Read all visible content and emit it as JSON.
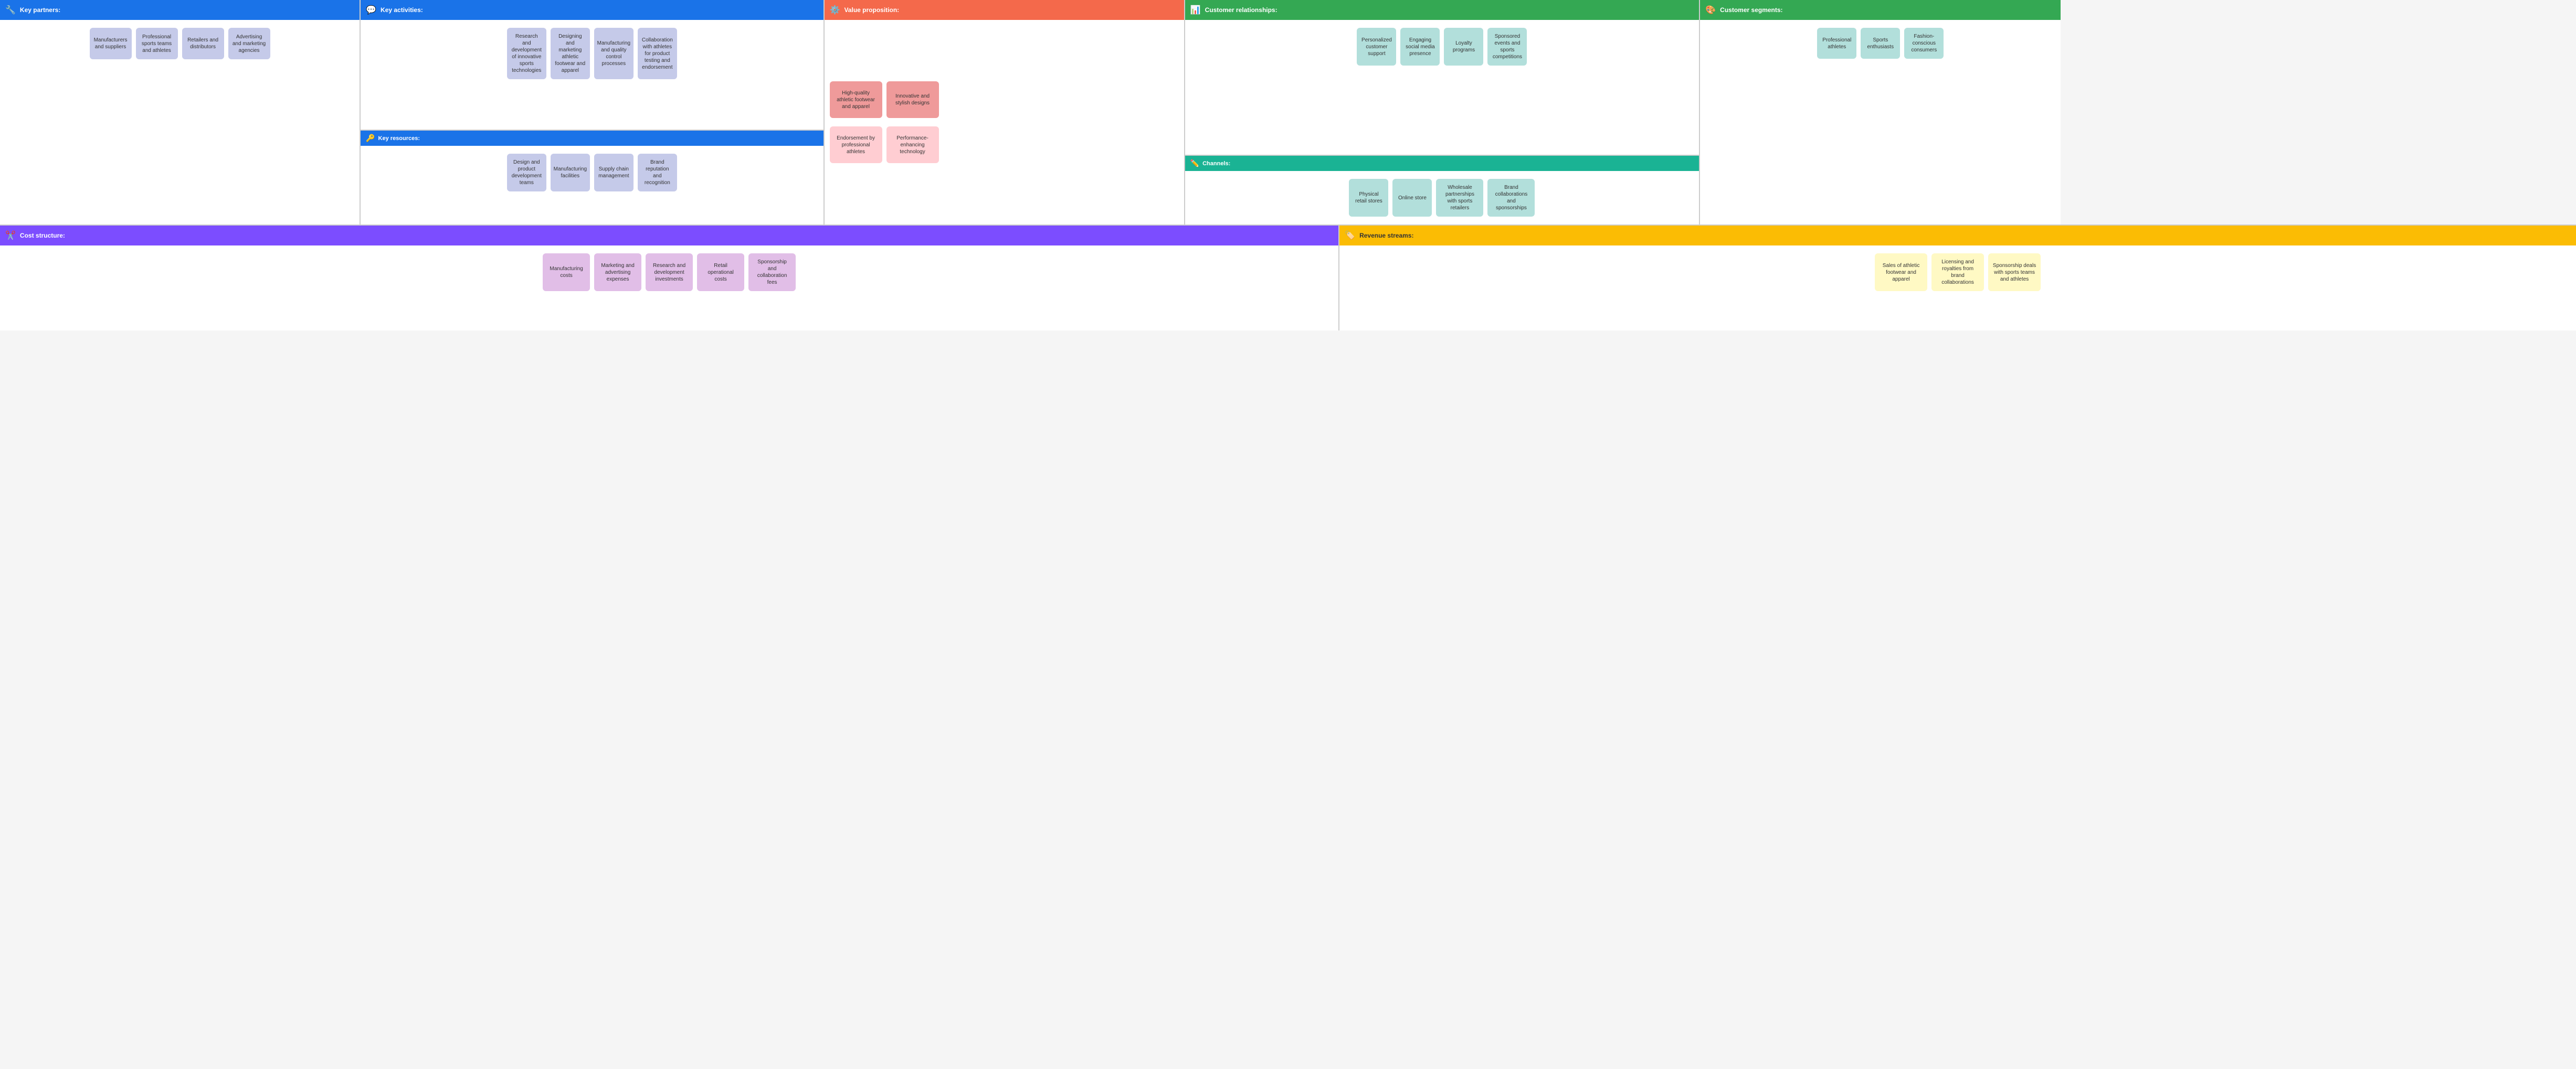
{
  "sections": {
    "keyPartners": {
      "title": "Key partners:",
      "icon": "🔧",
      "cards": [
        "Manufacturers and suppliers",
        "Professional sports teams and athletes",
        "Retailers and distributors",
        "Advertising and marketing agencies"
      ]
    },
    "keyActivities": {
      "title": "Key activities:",
      "icon": "💬",
      "cards": [
        "Research and development of innovative sports technologies",
        "Designing and marketing athletic footwear and apparel",
        "Manufacturing and quality control processes",
        "Collaboration with athletes for product testing and endorsement"
      ]
    },
    "keyResources": {
      "title": "Key resources:",
      "icon": "🔑",
      "cards": [
        "Design and product development teams",
        "Manufacturing facilities",
        "Supply chain management",
        "Brand reputation and recognition"
      ]
    },
    "valueProposition": {
      "title": "Value proposition:",
      "icon": "⚙️",
      "cards": [
        "High-quality athletic footwear and apparel",
        "Innovative and stylish designs",
        "Endorsement by professional athletes",
        "Performance-enhancing technology"
      ]
    },
    "customerRelationships": {
      "title": "Customer relationships:",
      "icon": "📊",
      "cards": [
        "Personalized customer support",
        "Engaging social media presence",
        "Loyalty programs",
        "Sponsored events and sports competitions"
      ]
    },
    "channels": {
      "title": "Channels:",
      "icon": "✏️",
      "cards": [
        "Physical retail stores",
        "Online store",
        "Wholesale partnerships with sports retailers",
        "Brand collaborations and sponsorships"
      ]
    },
    "customerSegments": {
      "title": "Customer segments:",
      "icon": "🎨",
      "cards": [
        "Professional athletes",
        "Sports enthusiasts",
        "Fashion-conscious consumers"
      ]
    },
    "costStructure": {
      "title": "Cost structure:",
      "icon": "✂️",
      "cards": [
        "Manufacturing costs",
        "Marketing and advertising expenses",
        "Research and development investments",
        "Retail operational costs",
        "Sponsorship and collaboration fees"
      ]
    },
    "revenueStreams": {
      "title": "Revenue streams:",
      "icon": "🏷️",
      "cards": [
        "Sales of athletic footwear and apparel",
        "Licensing and royalties from brand collaborations",
        "Sponsorship deals with sports teams and athletes"
      ]
    }
  }
}
